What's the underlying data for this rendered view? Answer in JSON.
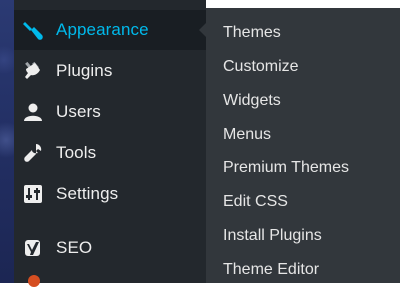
{
  "sidebar": {
    "items": [
      {
        "label": "Appearance",
        "icon": "paintbrush-icon",
        "active": true
      },
      {
        "label": "Plugins",
        "icon": "plug-icon"
      },
      {
        "label": "Users",
        "icon": "user-icon"
      },
      {
        "label": "Tools",
        "icon": "wrench-icon"
      },
      {
        "label": "Settings",
        "icon": "sliders-icon"
      },
      {
        "label": "SEO",
        "icon": "yoast-icon"
      }
    ]
  },
  "submenu": {
    "items": [
      {
        "label": "Themes"
      },
      {
        "label": "Customize"
      },
      {
        "label": "Widgets"
      },
      {
        "label": "Menus"
      },
      {
        "label": "Premium Themes"
      },
      {
        "label": "Edit CSS"
      },
      {
        "label": "Install Plugins"
      },
      {
        "label": "Theme Editor"
      }
    ]
  },
  "colors": {
    "sidebar_bg": "#23282d",
    "active_item_bg": "#191e23",
    "submenu_bg": "#32373c",
    "accent": "#00b9eb",
    "text": "#eeeeee"
  }
}
